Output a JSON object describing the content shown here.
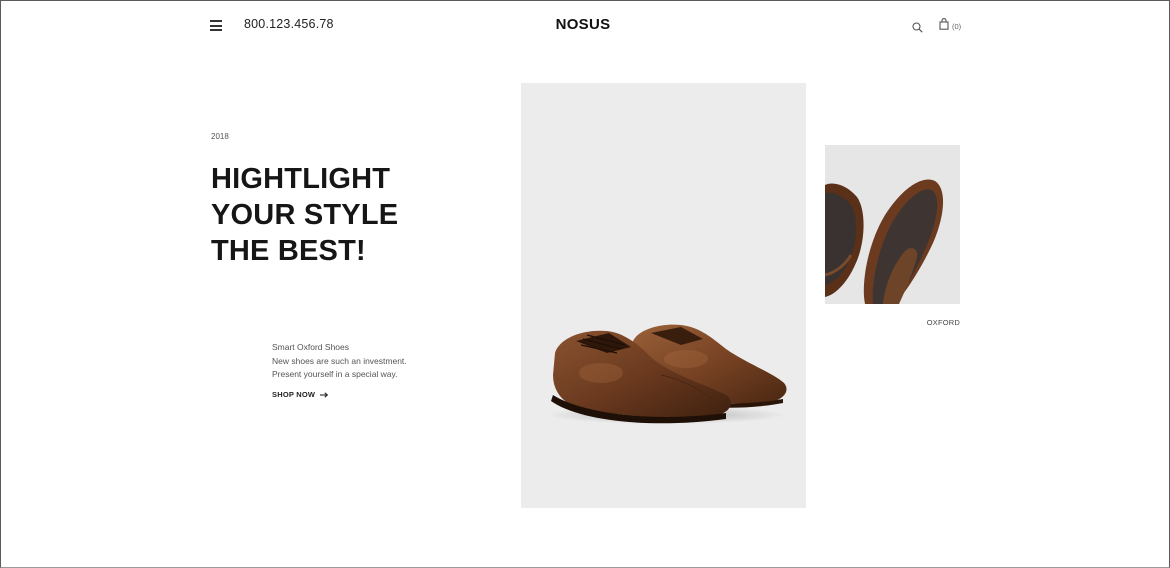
{
  "header": {
    "menu_icon": "hamburger-menu-icon",
    "phone": "800.123.456.78",
    "logo": "NOSUS",
    "search_icon": "search-icon",
    "cart_icon": "shopping-bag-icon",
    "cart_count": "(0)"
  },
  "hero": {
    "year": "2018",
    "headline_lines": [
      "HIGHTLIGHT",
      "YOUR STYLE",
      "THE BEST!"
    ],
    "product_name": "Smart Oxford Shoes",
    "description_lines": [
      "New shoes are such an investment.",
      "Present yourself in a special way."
    ],
    "cta_label": "SHOP NOW",
    "cta_icon": "arrow-right-icon"
  },
  "gallery": {
    "main_image_alt": "brown-oxford-shoes-image",
    "side_image_alt": "oxford-shoe-soles-image",
    "side_label": "OXFORD"
  },
  "colors": {
    "text": "#1a1a1a",
    "image_background": "#ececec",
    "leather": "#6b3a1f"
  }
}
